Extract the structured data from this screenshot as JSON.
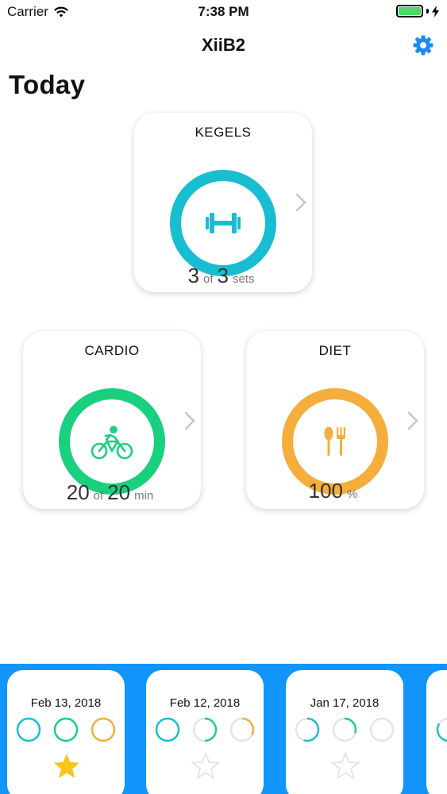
{
  "status_bar": {
    "carrier": "Carrier",
    "time": "7:38 PM",
    "battery_color": "#4cd964"
  },
  "nav": {
    "title": "XiiB2",
    "settings_icon": "gear-icon",
    "accent_color": "#1a8cf0"
  },
  "page_title": "Today",
  "cards": {
    "kegels": {
      "title": "KEGELS",
      "icon": "dumbbell-icon",
      "color": "#17bdd1",
      "value": "3",
      "of_label": "of",
      "target": "3",
      "unit": "sets",
      "progress": 1.0
    },
    "cardio": {
      "title": "CARDIO",
      "icon": "bicycle-icon",
      "color": "#19d07e",
      "value": "20",
      "of_label": "of",
      "target": "20",
      "unit": "min",
      "progress": 1.0
    },
    "diet": {
      "title": "DIET",
      "icon": "fork-spoon-icon",
      "color": "#f5ad3c",
      "value": "100",
      "unit": "%",
      "progress": 1.0
    }
  },
  "history": [
    {
      "date": "Feb 13, 2018",
      "kegels_progress": 1.0,
      "cardio_progress": 1.0,
      "diet_progress": 1.0,
      "starred": true
    },
    {
      "date": "Feb 12, 2018",
      "kegels_progress": 1.0,
      "cardio_progress": 0.5,
      "diet_progress": 0.33,
      "starred": false
    },
    {
      "date": "Jan 17, 2018",
      "kegels_progress": 0.55,
      "cardio_progress": 0.3,
      "diet_progress": 0.0,
      "starred": false
    }
  ],
  "colors": {
    "history_background": "#1195fb",
    "star_gold": "#f9c318",
    "star_empty": "#e2e2e2",
    "ring_track": "#e4e4e4"
  }
}
